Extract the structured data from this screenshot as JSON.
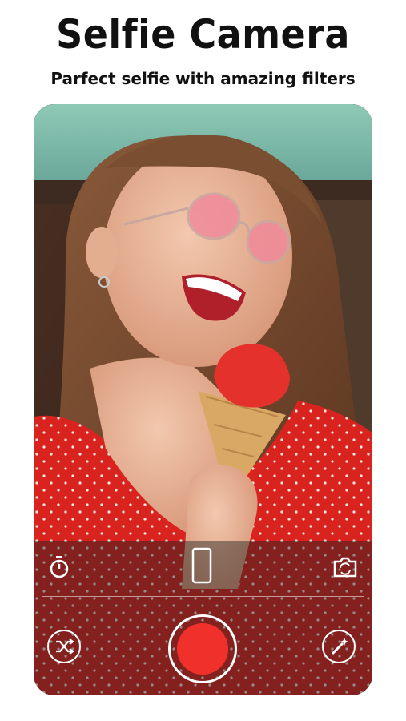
{
  "promo": {
    "title": "Selfie Camera",
    "subtitle": "Parfect selfie with amazing filters"
  },
  "camera": {
    "controls": [
      "timer-icon",
      "aspect-frame-icon",
      "flip-camera-icon",
      "shuffle-icon",
      "shutter-button",
      "magic-wand-icon"
    ],
    "shutter_color": "#f0302a"
  },
  "colors": {
    "dress_red": "#d8231f",
    "sky_teal": "#7fbfae"
  }
}
